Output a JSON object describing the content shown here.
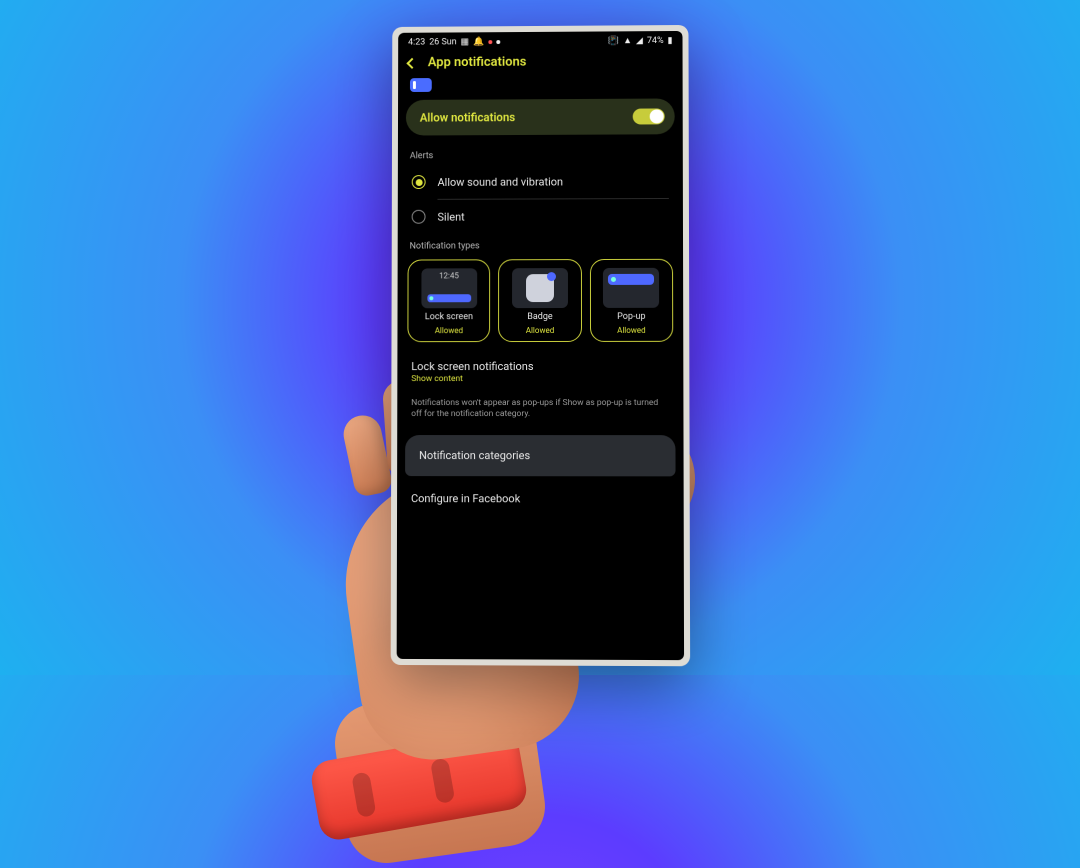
{
  "statusbar": {
    "time": "4:23",
    "date": "26 Sun",
    "battery": "74%"
  },
  "header": {
    "title": "App notifications"
  },
  "allow": {
    "label": "Allow notifications",
    "on": true
  },
  "alerts": {
    "section": "Alerts",
    "sound": "Allow sound and vibration",
    "silent": "Silent"
  },
  "types": {
    "section": "Notification types",
    "lock": {
      "title": "Lock screen",
      "sub": "Allowed",
      "time": "12:45"
    },
    "badge": {
      "title": "Badge",
      "sub": "Allowed"
    },
    "popup": {
      "title": "Pop-up",
      "sub": "Allowed"
    }
  },
  "lockscreen": {
    "title": "Lock screen notifications",
    "sub": "Show content"
  },
  "info": "Notifications won't appear as pop-ups if Show as pop-up is turned off for the notification category.",
  "categories": "Notification categories",
  "configure": "Configure in Facebook"
}
